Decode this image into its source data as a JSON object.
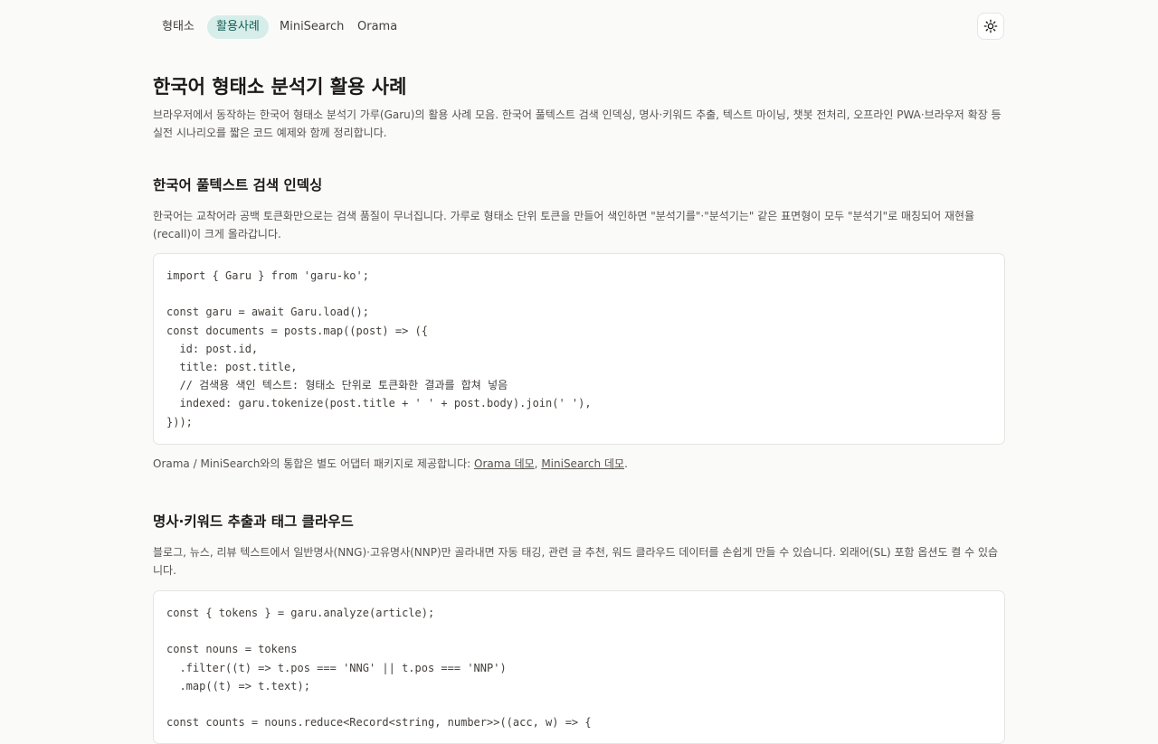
{
  "nav": {
    "tabs": [
      {
        "label": "형태소",
        "active": false
      },
      {
        "label": "활용사례",
        "active": true
      },
      {
        "label": "MiniSearch",
        "active": false
      },
      {
        "label": "Orama",
        "active": false
      }
    ],
    "theme_icon": "sun-icon"
  },
  "page": {
    "title": "한국어 형태소 분석기 활용 사례",
    "description": "브라우저에서 동작하는 한국어 형태소 분석기 가루(Garu)의 활용 사례 모음. 한국어 풀텍스트 검색 인덱싱, 명사·키워드 추출, 텍스트 마이닝, 챗봇 전처리, 오프라인 PWA·브라우저 확장 등 실전 시나리오를 짧은 코드 예제와 함께 정리합니다."
  },
  "sections": [
    {
      "title": "한국어 풀텍스트 검색 인덱싱",
      "description": "한국어는 교착어라 공백 토큰화만으로는 검색 품질이 무너집니다. 가루로 형태소 단위 토큰을 만들어 색인하면 \"분석기를\"·\"분석기는\" 같은 표면형이 모두 \"분석기\"로 매칭되어 재현율(recall)이 크게 올라갑니다.",
      "code": [
        "import { Garu } from 'garu-ko';",
        "",
        "const garu = await Garu.load();",
        "const documents = posts.map((post) => ({",
        "  id: post.id,",
        "  title: post.title,",
        "  // 검색용 색인 텍스트: 형태소 단위로 토큰화한 결과를 합쳐 넣음",
        "  indexed: garu.tokenize(post.title + ' ' + post.body).join(' '),",
        "}));"
      ],
      "note": {
        "prefix": "Orama / MiniSearch와의 통합은 별도 어댑터 패키지로 제공합니다: ",
        "link1": "Orama 데모",
        "separator": ", ",
        "link2": "MiniSearch 데모",
        "suffix": "."
      }
    },
    {
      "title": "명사·키워드 추출과 태그 클라우드",
      "description": "블로그, 뉴스, 리뷰 텍스트에서 일반명사(NNG)·고유명사(NNP)만 골라내면 자동 태깅, 관련 글 추천, 워드 클라우드 데이터를 손쉽게 만들 수 있습니다. 외래어(SL) 포함 옵션도 켤 수 있습니다.",
      "code": [
        "const { tokens } = garu.analyze(article);",
        "",
        "const nouns = tokens",
        "  .filter((t) => t.pos === 'NNG' || t.pos === 'NNP')",
        "  .map((t) => t.text);",
        "",
        "const counts = nouns.reduce<Record<string, number>>((acc, w) => {"
      ]
    }
  ]
}
